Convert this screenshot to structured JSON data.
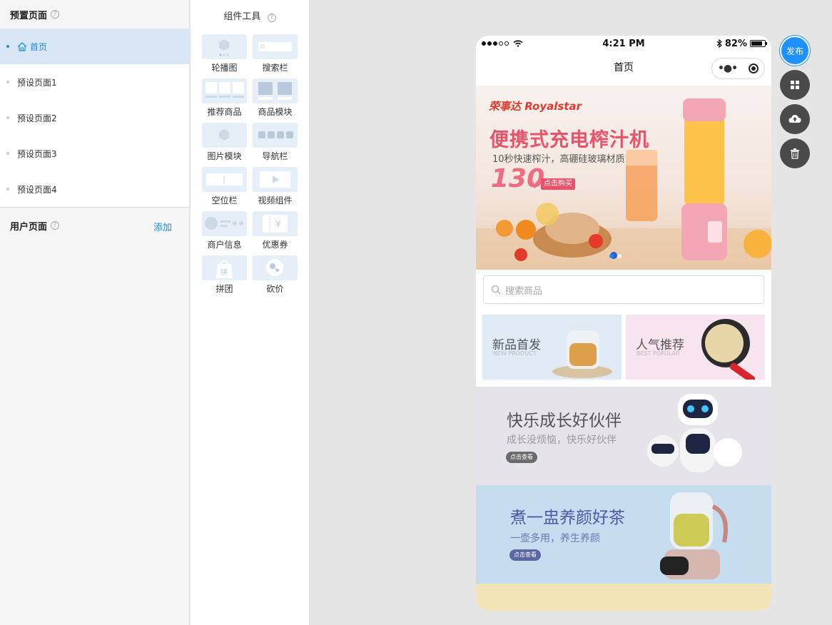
{
  "pages_panel": {
    "preset_title": "预置页面",
    "preset_items": [
      {
        "label": "首页",
        "active": true
      },
      {
        "label": "预设页面1"
      },
      {
        "label": "预设页面2"
      },
      {
        "label": "预设页面3"
      },
      {
        "label": "预设页面4"
      }
    ],
    "user_title": "用户页面",
    "add_label": "添加"
  },
  "tools_panel": {
    "title": "组件工具",
    "tools": [
      {
        "label": "轮播图",
        "icon": "carousel-icon"
      },
      {
        "label": "搜索栏",
        "icon": "search-bar-icon"
      },
      {
        "label": "推荐商品",
        "icon": "recommend-goods-icon"
      },
      {
        "label": "商品模块",
        "icon": "goods-module-icon"
      },
      {
        "label": "图片模块",
        "icon": "image-module-icon"
      },
      {
        "label": "导航栏",
        "icon": "nav-bar-icon"
      },
      {
        "label": "空位栏",
        "icon": "spacer-icon"
      },
      {
        "label": "视频组件",
        "icon": "video-icon"
      },
      {
        "label": "商户信息",
        "icon": "merchant-info-icon"
      },
      {
        "label": "优惠券",
        "icon": "coupon-icon"
      },
      {
        "label": "拼团",
        "icon": "group-buy-icon"
      },
      {
        "label": "砍价",
        "icon": "bargain-icon"
      }
    ]
  },
  "phone": {
    "status": {
      "time": "4:21 PM",
      "battery": "82%",
      "battery_level": 0.82
    },
    "nav_title": "首页",
    "banner": {
      "brand": "荣事达 Royalstar",
      "headline": "便携式充电榨汁机",
      "subline": "10秒快速榨汁，高硼硅玻璃材质",
      "price": "130",
      "currency": "¥",
      "button": "点击购买"
    },
    "search_placeholder": "搜索商品",
    "promo_left": {
      "title": "新品首发",
      "subtitle": "NEW PRODUCT"
    },
    "promo_right": {
      "title": "人气推荐",
      "subtitle": "BEST POPULAR"
    },
    "robot_banner": {
      "title": "快乐成长好伙伴",
      "subtitle": "成长没烦恼，快乐好伙伴",
      "button": "点击查看"
    },
    "tea_banner": {
      "title": "煮一盅养颜好茶",
      "subtitle": "一壶多用，养生养颜",
      "button": "点击查看"
    }
  },
  "actions": {
    "publish": "发布"
  },
  "colors": {
    "accent": "#1a8be8",
    "banner_pink": "#e8536a"
  }
}
